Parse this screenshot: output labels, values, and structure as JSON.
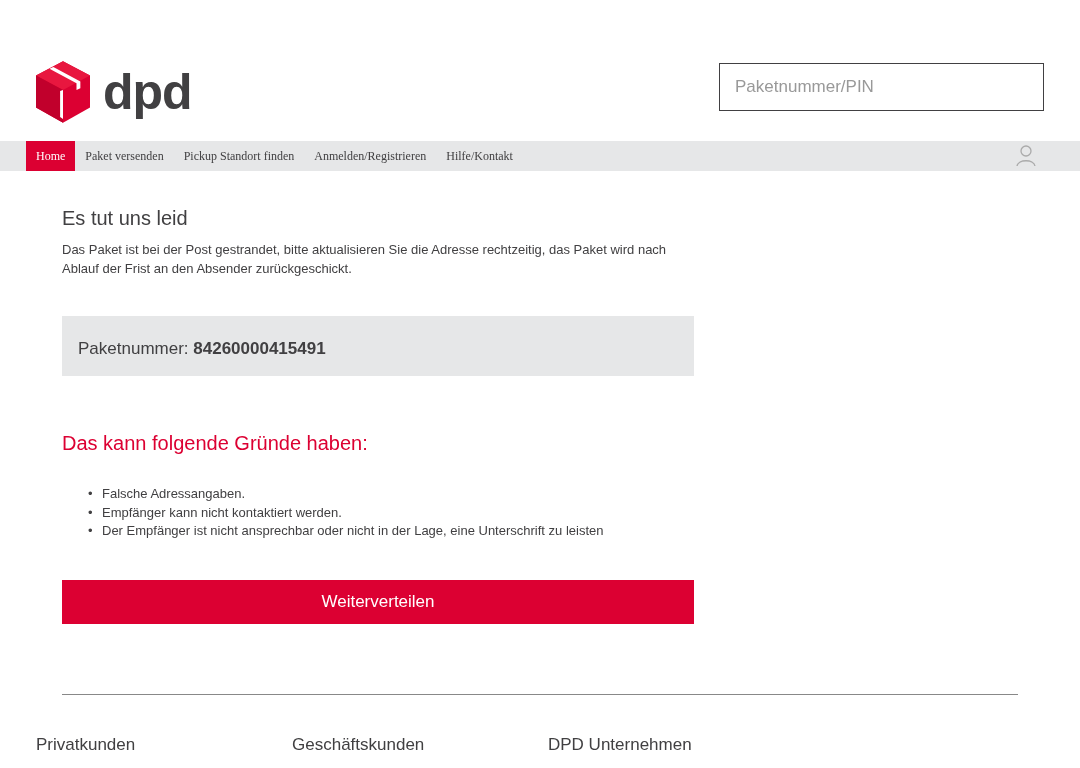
{
  "logo": {
    "text": "dpd"
  },
  "search": {
    "placeholder": "Paketnummer/PIN"
  },
  "nav": [
    {
      "label": "Home",
      "selected": true
    },
    {
      "label": "Paket versenden",
      "selected": false
    },
    {
      "label": "Pickup Standort finden",
      "selected": false
    },
    {
      "label": "Anmelden/Registrieren",
      "selected": false
    },
    {
      "label": "Hilfe/Kontakt",
      "selected": false
    }
  ],
  "main": {
    "title": "Es tut uns leid",
    "message": "Das Paket ist bei der Post gestrandet, bitte aktualisieren Sie die Adresse rechtzeitig, das Paket wird nach Ablauf der Frist an den Absender zurückgeschickt.",
    "parcel": "Paketnummer: **84260000415491**",
    "reasons_title": "Das kann folgende Gründe haben:",
    "reasons": [
      {
        "bullet": "•",
        "text": "Falsche Adressangaben."
      },
      {
        "bullet": "•",
        "text": "Empfänger kann nicht kontaktiert werden."
      },
      {
        "bullet": "•",
        "text": "Der Empfänger ist nicht ansprechbar oder nicht in der Lage, eine Unterschrift zu leisten"
      }
    ],
    "button": "Weiterverteilen"
  },
  "footer": [
    "Privatkunden",
    "Geschäftskunden",
    "DPD Unternehmen"
  ]
}
